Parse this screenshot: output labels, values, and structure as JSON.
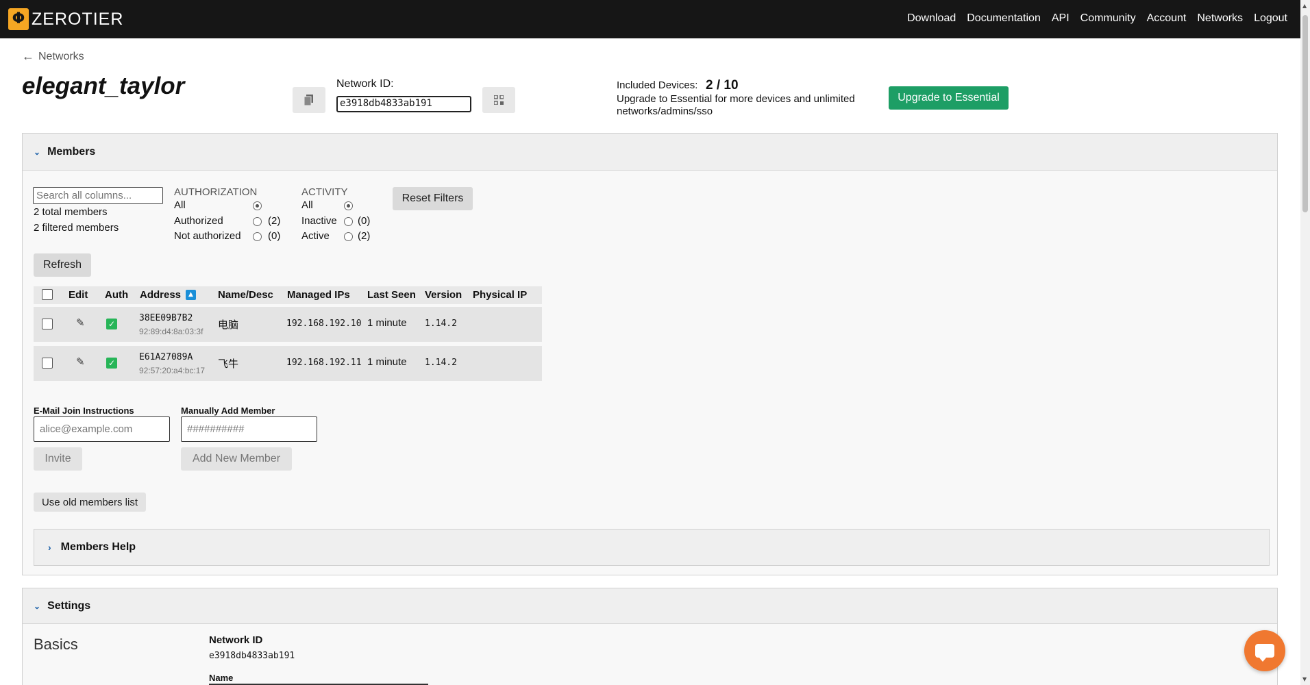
{
  "brand": {
    "logo_glyph": "Φ",
    "name": "ZEROTIER"
  },
  "nav": [
    "Download",
    "Documentation",
    "API",
    "Community",
    "Account",
    "Networks",
    "Logout"
  ],
  "back_link": "Networks",
  "network": {
    "name": "elegant_taylor",
    "id_label": "Network ID:",
    "id": "e3918db4833ab191"
  },
  "plan": {
    "included_label": "Included Devices:",
    "included_count": "2 / 10",
    "upgrade_text": "Upgrade to Essential for more devices and unlimited networks/admins/sso",
    "upgrade_button": "Upgrade to Essential"
  },
  "members": {
    "title": "Members",
    "search_placeholder": "Search all columns...",
    "total": "2 total members",
    "filtered": "2 filtered members",
    "authorization": {
      "heading": "AUTHORIZATION",
      "options": [
        {
          "label": "All",
          "count": "",
          "selected": true
        },
        {
          "label": "Authorized",
          "count": "(2)",
          "selected": false
        },
        {
          "label": "Not authorized",
          "count": "(0)",
          "selected": false
        }
      ]
    },
    "activity": {
      "heading": "ACTIVITY",
      "options": [
        {
          "label": "All",
          "count": "",
          "selected": true
        },
        {
          "label": "Inactive",
          "count": "(0)",
          "selected": false
        },
        {
          "label": "Active",
          "count": "(2)",
          "selected": false
        }
      ]
    },
    "reset_button": "Reset Filters",
    "refresh_button": "Refresh",
    "columns": [
      "Edit",
      "Auth",
      "Address",
      "Name/Desc",
      "Managed IPs",
      "Last Seen",
      "Version",
      "Physical IP"
    ],
    "rows": [
      {
        "address": "38EE09B7B2",
        "mac": "92:89:d4:8a:03:3f",
        "name": "电脑",
        "ip": "192.168.192.10",
        "last_seen": "1 minute",
        "version": "1.14.2",
        "physical_ip": ""
      },
      {
        "address": "E61A27089A",
        "mac": "92:57:20:a4:bc:17",
        "name": "飞牛",
        "ip": "192.168.192.11",
        "last_seen": "1 minute",
        "version": "1.14.2",
        "physical_ip": ""
      }
    ],
    "email_label": "E-Mail Join Instructions",
    "email_placeholder": "alice@example.com",
    "invite_button": "Invite",
    "manual_label": "Manually Add Member",
    "manual_placeholder": "##########",
    "add_button": "Add New Member",
    "old_list_button": "Use old members list",
    "help_title": "Members Help"
  },
  "settings": {
    "title": "Settings",
    "basics": "Basics",
    "network_id_label": "Network ID",
    "network_id": "e3918db4833ab191",
    "name_label": "Name"
  },
  "colors": {
    "accent_green": "#1d9e65",
    "auth_green": "#27b558",
    "chat_orange": "#f07830",
    "topbar": "#161616"
  },
  "icons": [
    "arrow-left-icon",
    "copy-icon",
    "qr-code-icon",
    "chevron-down-icon",
    "chevron-right-icon",
    "sort-up-icon",
    "edit-icon",
    "checkmark-icon",
    "chat-icon"
  ]
}
